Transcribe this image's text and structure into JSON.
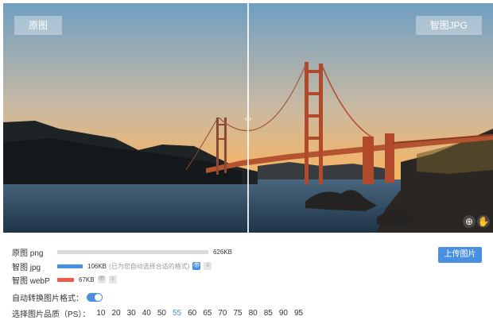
{
  "viewer": {
    "left_label": "原图",
    "right_label": "智图JPG",
    "divider_glyph": "‹ ›",
    "zoom_icon": "magnifier-plus",
    "hand_icon": "hand-pan"
  },
  "formats": [
    {
      "label": "原图 png",
      "size": "626KB",
      "bar_fraction": 1.0,
      "bar_color": "#d9d9d9"
    },
    {
      "label": "智图 jpg",
      "size": "106KB",
      "hint": "(已为您自动选择合适的格式)",
      "bar_fraction": 0.17,
      "bar_color": "#4a90e2"
    },
    {
      "label": "智图 webP",
      "size": "67KB",
      "bar_fraction": 0.11,
      "bar_color": "#ec5b4b"
    }
  ],
  "auto_convert_label": "自动转换图片格式：",
  "auto_convert_on": true,
  "quality": {
    "label": "选择图片品质（PS）：",
    "options": [
      "10",
      "20",
      "30",
      "40",
      "50",
      "55",
      "60",
      "65",
      "70",
      "75",
      "80",
      "85",
      "90",
      "95"
    ],
    "selected": "55"
  },
  "upload_button": "上传图片",
  "colors": {
    "accent": "#4a90e2",
    "webp": "#ec5b4b",
    "original_bar": "#d9d9d9"
  }
}
